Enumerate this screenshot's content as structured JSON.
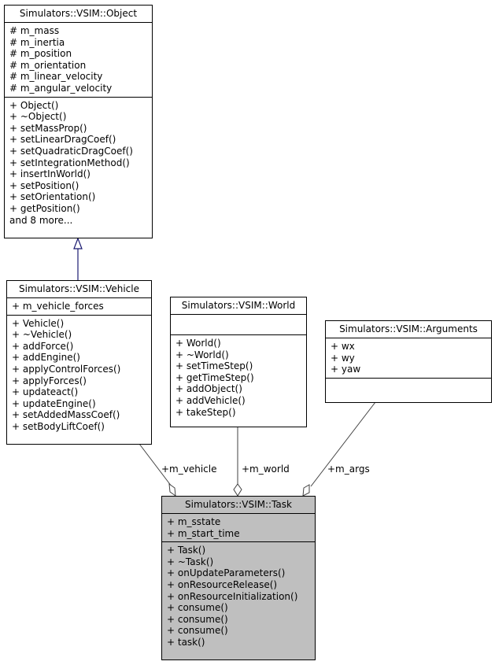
{
  "classes": {
    "object": {
      "name": "Simulators::VSIM::Object",
      "attributes": [
        "# m_mass",
        "# m_inertia",
        "# m_position",
        "# m_orientation",
        "# m_linear_velocity",
        "# m_angular_velocity"
      ],
      "methods": [
        "+ Object()",
        "+ ~Object()",
        "+ setMassProp()",
        "+ setLinearDragCoef()",
        "+ setQuadraticDragCoef()",
        "+ setIntegrationMethod()",
        "+ insertInWorld()",
        "+ setPosition()",
        "+ setOrientation()",
        "+ getPosition()",
        "and 8 more..."
      ]
    },
    "vehicle": {
      "name": "Simulators::VSIM::Vehicle",
      "attributes": [
        "+ m_vehicle_forces"
      ],
      "methods": [
        "+ Vehicle()",
        "+ ~Vehicle()",
        "+ addForce()",
        "+ addEngine()",
        "+ applyControlForces()",
        "+ applyForces()",
        "+ updateact()",
        "+ updateEngine()",
        "+ setAddedMassCoef()",
        "+ setBodyLiftCoef()"
      ]
    },
    "world": {
      "name": "Simulators::VSIM::World",
      "attributes": [],
      "methods": [
        "+ World()",
        "+ ~World()",
        "+ setTimeStep()",
        "+ getTimeStep()",
        "+ addObject()",
        "+ addVehicle()",
        "+ takeStep()"
      ]
    },
    "arguments": {
      "name": "Simulators::VSIM::Arguments",
      "attributes": [
        "+ wx",
        "+ wy",
        "+ yaw"
      ],
      "methods": []
    },
    "task": {
      "name": "Simulators::VSIM::Task",
      "attributes": [
        "+ m_sstate",
        "+ m_start_time"
      ],
      "methods": [
        "+ Task()",
        "+ ~Task()",
        "+ onUpdateParameters()",
        "+ onResourceRelease()",
        "+ onResourceInitialization()",
        "+ consume()",
        "+ consume()",
        "+ consume()",
        "+ task()"
      ]
    }
  },
  "relations": {
    "inheritance": {
      "from": "Simulators::VSIM::Vehicle",
      "to": "Simulators::VSIM::Object",
      "color": "#191970"
    },
    "aggregations": [
      {
        "label": "+m_vehicle",
        "from": "Simulators::VSIM::Vehicle",
        "to": "Simulators::VSIM::Task"
      },
      {
        "label": "+m_world",
        "from": "Simulators::VSIM::World",
        "to": "Simulators::VSIM::Task"
      },
      {
        "label": "+m_args",
        "from": "Simulators::VSIM::Arguments",
        "to": "Simulators::VSIM::Task"
      }
    ]
  },
  "colors": {
    "highlight_fill": "#bfbfbf",
    "inheritance_edge": "#191970",
    "aggregation_edge": "#404040"
  }
}
